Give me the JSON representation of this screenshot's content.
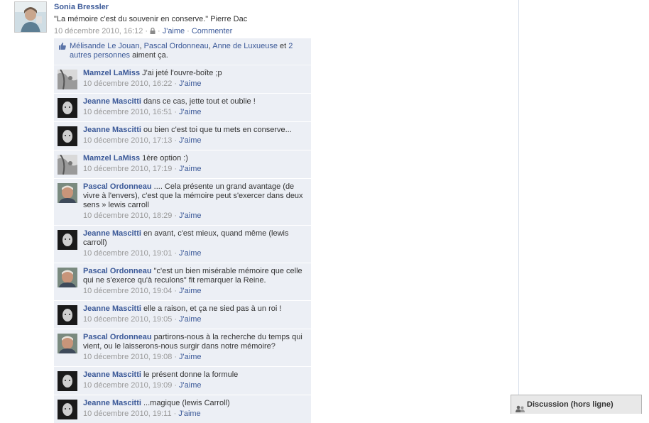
{
  "post": {
    "author": "Sonia Bressler",
    "text": "\"La mémoire c'est du souvenir en conserve.\" Pierre Dac",
    "timestamp": "10 décembre 2010, 16:12",
    "like_label": "J'aime",
    "comment_label": "Commenter"
  },
  "likes": {
    "names": [
      "Mélisande Le Jouan",
      "Pascal Ordonneau",
      "Anne de Luxueuse"
    ],
    "et": "et",
    "others_label": "2 autres personnes",
    "suffix": "aiment ça."
  },
  "comments": [
    {
      "author": "Mamzel LaMiss",
      "text": "J'ai jeté l'ouvre-boîte ;p",
      "time": "10 décembre 2010, 16:22",
      "like": "J'aime",
      "avatar": "lamiss"
    },
    {
      "author": "Jeanne Mascitti",
      "text": "dans ce cas, jette tout et oublie !",
      "time": "10 décembre 2010, 16:51",
      "like": "J'aime",
      "avatar": "jeanne"
    },
    {
      "author": "Jeanne Mascitti",
      "text": "ou bien c'est toi que tu mets en conserve...",
      "time": "10 décembre 2010, 17:13",
      "like": "J'aime",
      "avatar": "jeanne"
    },
    {
      "author": "Mamzel LaMiss",
      "text": "1ère option :)",
      "time": "10 décembre 2010, 17:19",
      "like": "J'aime",
      "avatar": "lamiss"
    },
    {
      "author": "Pascal Ordonneau",
      "text": ".... Cela présente un grand avantage (de vivre à l'envers), c'est que la mémoire peut s'exercer dans deux sens » lewis carroll",
      "time": "10 décembre 2010, 18:29",
      "like": "J'aime",
      "avatar": "pascal"
    },
    {
      "author": "Jeanne Mascitti",
      "text": "en avant, c'est mieux, quand même (lewis carroll)",
      "time": "10 décembre 2010, 19:01",
      "like": "J'aime",
      "avatar": "jeanne"
    },
    {
      "author": "Pascal Ordonneau",
      "text": "\"c'est un bien misérable mémoire que celle qui ne s'exerce qu'à reculons\" fit remarquer la Reine.",
      "time": "10 décembre 2010, 19:04",
      "like": "J'aime",
      "avatar": "pascal"
    },
    {
      "author": "Jeanne Mascitti",
      "text": "elle a raison, et ça ne sied pas à un roi !",
      "time": "10 décembre 2010, 19:05",
      "like": "J'aime",
      "avatar": "jeanne"
    },
    {
      "author": "Pascal Ordonneau",
      "text": "partirons-nous à la recherche du temps qui vient, ou le laisserons-nous surgir dans notre mémoire?",
      "time": "10 décembre 2010, 19:08",
      "like": "J'aime",
      "avatar": "pascal"
    },
    {
      "author": "Jeanne Mascitti",
      "text": "le présent donne la formule",
      "time": "10 décembre 2010, 19:09",
      "like": "J'aime",
      "avatar": "jeanne"
    },
    {
      "author": "Jeanne Mascitti",
      "text": "...magique (lewis Carroll)",
      "time": "10 décembre 2010, 19:11",
      "like": "J'aime",
      "avatar": "jeanne"
    }
  ],
  "chat": {
    "label": "Discussion (hors ligne)"
  },
  "colors": {
    "link": "#3b5998",
    "feedback_bg": "#eceff5",
    "meta": "#999999"
  },
  "icons": {
    "thumb": "thumbs-up-icon",
    "lock": "lock-icon",
    "chat": "chat-users-icon"
  }
}
